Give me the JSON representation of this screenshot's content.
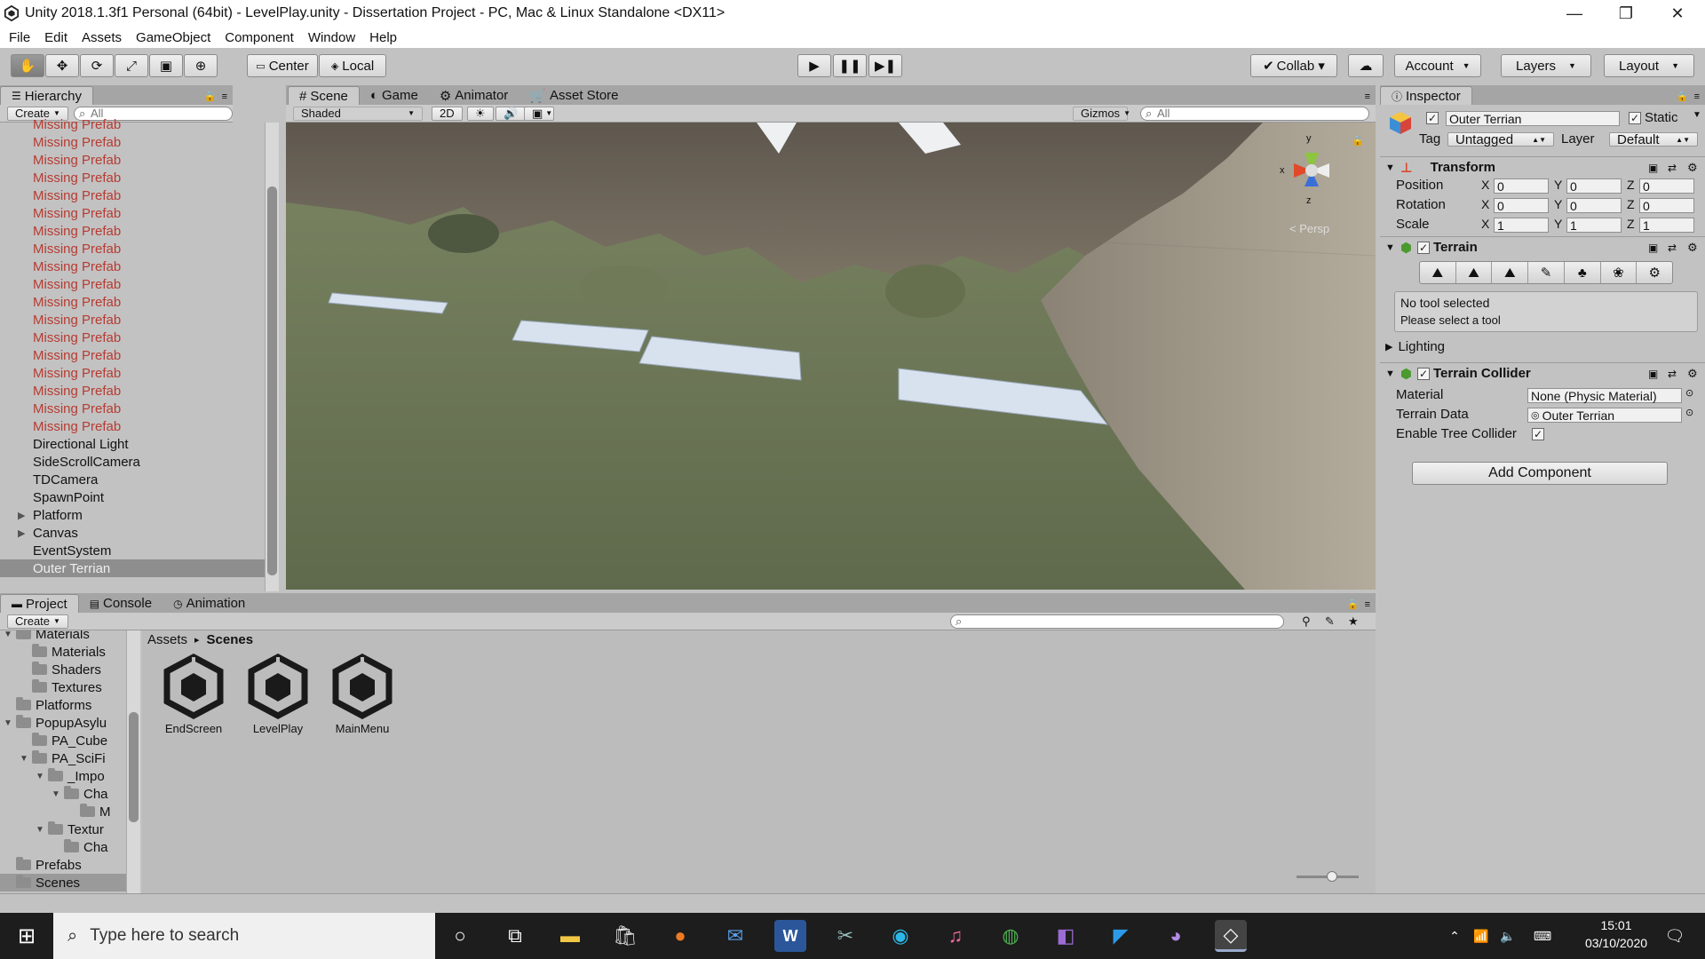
{
  "window": {
    "title": "Unity 2018.1.3f1 Personal (64bit) - LevelPlay.unity - Dissertation Project - PC, Mac & Linux Standalone <DX11>",
    "minimize": "—",
    "maximize": "❐",
    "close": "✕"
  },
  "menu": [
    "File",
    "Edit",
    "Assets",
    "GameObject",
    "Component",
    "Window",
    "Help"
  ],
  "toolbar": {
    "pivot": "Center",
    "space": "Local",
    "collab": "Collab ▾",
    "account": "Account",
    "layers": "Layers",
    "layout": "Layout"
  },
  "hierarchy": {
    "tab": "Hierarchy",
    "create": "Create",
    "search_placeholder": "All",
    "items": [
      {
        "label": "Missing Prefab",
        "type": "missing",
        "expand": ""
      },
      {
        "label": "Missing Prefab",
        "type": "missing",
        "expand": ""
      },
      {
        "label": "Missing Prefab",
        "type": "missing",
        "expand": ""
      },
      {
        "label": "Missing Prefab",
        "type": "missing",
        "expand": ""
      },
      {
        "label": "Missing Prefab",
        "type": "missing",
        "expand": ""
      },
      {
        "label": "Missing Prefab",
        "type": "missing",
        "expand": ""
      },
      {
        "label": "Missing Prefab",
        "type": "missing",
        "expand": ""
      },
      {
        "label": "Missing Prefab",
        "type": "missing",
        "expand": ""
      },
      {
        "label": "Missing Prefab",
        "type": "missing",
        "expand": ""
      },
      {
        "label": "Missing Prefab",
        "type": "missing",
        "expand": ""
      },
      {
        "label": "Missing Prefab",
        "type": "missing",
        "expand": ""
      },
      {
        "label": "Missing Prefab",
        "type": "missing",
        "expand": ""
      },
      {
        "label": "Missing Prefab",
        "type": "missing",
        "expand": ""
      },
      {
        "label": "Missing Prefab",
        "type": "missing",
        "expand": ""
      },
      {
        "label": "Missing Prefab",
        "type": "missing",
        "expand": ""
      },
      {
        "label": "Missing Prefab",
        "type": "missing",
        "expand": ""
      },
      {
        "label": "Missing Prefab",
        "type": "missing",
        "expand": ""
      },
      {
        "label": "Missing Prefab",
        "type": "missing",
        "expand": ""
      },
      {
        "label": "Directional Light",
        "type": "normal",
        "expand": ""
      },
      {
        "label": "SideScrollCamera",
        "type": "normal",
        "expand": ""
      },
      {
        "label": "TDCamera",
        "type": "normal",
        "expand": ""
      },
      {
        "label": "SpawnPoint",
        "type": "normal",
        "expand": ""
      },
      {
        "label": "Platform",
        "type": "normal",
        "expand": "▶"
      },
      {
        "label": "Canvas",
        "type": "normal",
        "expand": "▶"
      },
      {
        "label": "EventSystem",
        "type": "normal",
        "expand": ""
      },
      {
        "label": "Outer Terrian",
        "type": "selected",
        "expand": ""
      }
    ]
  },
  "scene": {
    "tabs": [
      "Scene",
      "Game",
      "Animator",
      "Asset Store"
    ],
    "tab_icons": [
      "#",
      "◐",
      "⚙",
      "🛒"
    ],
    "shading": "Shaded",
    "mode2d": "2D",
    "gizmos": "Gizmos",
    "search_placeholder": "All",
    "persp": "< Persp",
    "axis_x": "x",
    "axis_y": "y",
    "axis_z": "z"
  },
  "inspector": {
    "tab": "Inspector",
    "object_name": "Outer Terrian",
    "static_label": "Static",
    "tag_label": "Tag",
    "tag_value": "Untagged",
    "layer_label": "Layer",
    "layer_value": "Default",
    "transform": {
      "title": "Transform",
      "rows": [
        {
          "label": "Position",
          "x": "0",
          "y": "0",
          "z": "0"
        },
        {
          "label": "Rotation",
          "x": "0",
          "y": "0",
          "z": "0"
        },
        {
          "label": "Scale",
          "x": "1",
          "y": "1",
          "z": "1"
        }
      ]
    },
    "terrain": {
      "title": "Terrain",
      "msg1": "No tool selected",
      "msg2": "Please select a tool",
      "lighting": "Lighting"
    },
    "collider": {
      "title": "Terrain Collider",
      "material_label": "Material",
      "material_value": "None (Physic Material)",
      "data_label": "Terrain Data",
      "data_value": "Outer Terrian",
      "tree_label": "Enable Tree Collider"
    },
    "add_component": "Add Component"
  },
  "project": {
    "tabs": [
      "Project",
      "Console",
      "Animation"
    ],
    "create": "Create",
    "breadcrumb_root": "Assets",
    "breadcrumb_sep": "▸",
    "breadcrumb_current": "Scenes",
    "tree": [
      {
        "label": "Materials",
        "indent": 0,
        "arrow": "▼"
      },
      {
        "label": "Materials",
        "indent": 1,
        "arrow": ""
      },
      {
        "label": "Shaders",
        "indent": 1,
        "arrow": ""
      },
      {
        "label": "Textures",
        "indent": 1,
        "arrow": ""
      },
      {
        "label": "Platforms",
        "indent": 0,
        "arrow": ""
      },
      {
        "label": "PopupAsylu",
        "indent": 0,
        "arrow": "▼"
      },
      {
        "label": "PA_Cube",
        "indent": 1,
        "arrow": ""
      },
      {
        "label": "PA_SciFi",
        "indent": 1,
        "arrow": "▼"
      },
      {
        "label": "_Impo",
        "indent": 2,
        "arrow": "▼"
      },
      {
        "label": "Cha",
        "indent": 3,
        "arrow": "▼"
      },
      {
        "label": "M",
        "indent": 4,
        "arrow": ""
      },
      {
        "label": "Textur",
        "indent": 2,
        "arrow": "▼"
      },
      {
        "label": "Cha",
        "indent": 3,
        "arrow": ""
      },
      {
        "label": "Prefabs",
        "indent": 0,
        "arrow": ""
      },
      {
        "label": "Scenes",
        "indent": 0,
        "arrow": ""
      }
    ],
    "assets": [
      "EndScreen",
      "LevelPlay",
      "MainMenu"
    ]
  },
  "taskbar": {
    "search_placeholder": "Type here to search",
    "time": "15:01",
    "date": "03/10/2020"
  }
}
